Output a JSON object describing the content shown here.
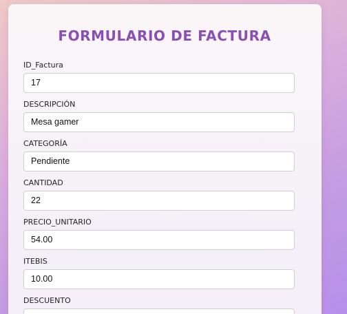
{
  "form": {
    "title": "FORMULARIO DE FACTURA",
    "fields": [
      {
        "label": "ID_Factura",
        "value": "17"
      },
      {
        "label": "DESCRIPCIÓN",
        "value": "Mesa gamer"
      },
      {
        "label": "CATEGORÍA",
        "value": "Pendiente"
      },
      {
        "label": "CANTIDAD",
        "value": "22"
      },
      {
        "label": "PRECIO_UNITARIO",
        "value": "54.00"
      },
      {
        "label": "ITEBIS",
        "value": "10.00"
      },
      {
        "label": "DESCUENTO",
        "value": ""
      }
    ]
  }
}
